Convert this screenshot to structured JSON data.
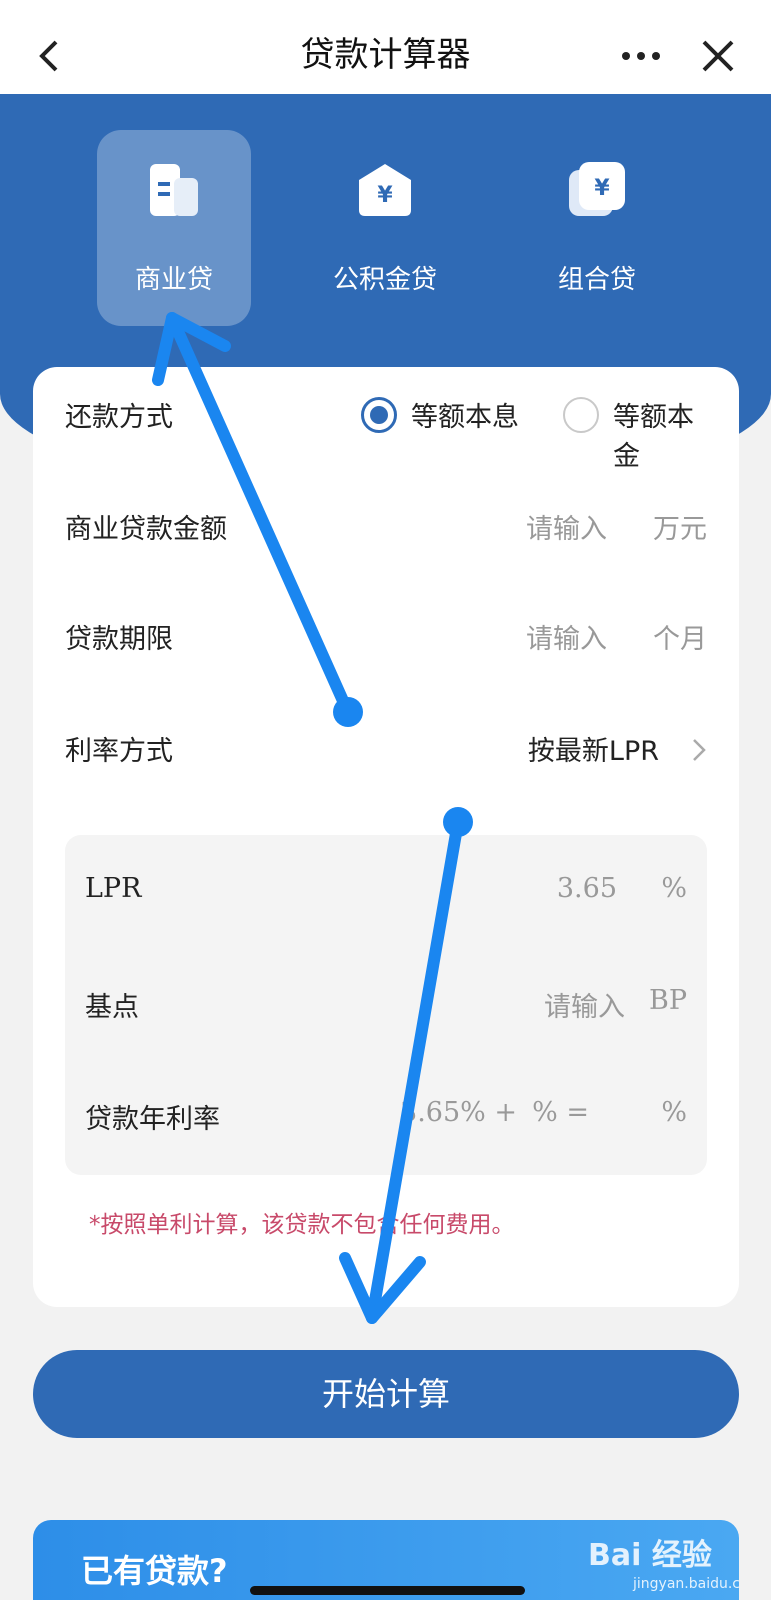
{
  "nav": {
    "title": "贷款计算器",
    "back_icon": "chevron-left-icon",
    "more_icon": "ellipsis-icon",
    "close_icon": "close-icon"
  },
  "tabs": [
    {
      "label": "商业贷",
      "icon": "building-icon",
      "active": true
    },
    {
      "label": "公积金贷",
      "icon": "house-yuan-icon",
      "active": false
    },
    {
      "label": "组合贷",
      "icon": "yuan-cards-icon",
      "active": false
    }
  ],
  "form": {
    "repay_method_label": "还款方式",
    "repay_options": [
      {
        "label": "等额本息",
        "selected": true
      },
      {
        "label": "等额本金",
        "selected": false
      }
    ],
    "amount_label": "商业贷款金额",
    "amount_placeholder": "请输入",
    "amount_unit": "万元",
    "term_label": "贷款期限",
    "term_placeholder": "请输入",
    "term_unit": "个月",
    "rate_method_label": "利率方式",
    "rate_method_value": "按最新LPR",
    "lpr_label": "LPR",
    "lpr_value": "3.65",
    "lpr_unit": "%",
    "bp_label": "基点",
    "bp_placeholder": "请输入",
    "bp_unit": "BP",
    "annual_rate_label": "贷款年利率",
    "annual_rate_formula_a": "3.65% +",
    "annual_rate_formula_b": "% =",
    "annual_rate_unit": "%",
    "note": "*按照单利计算，该贷款不包含任何费用。"
  },
  "action": {
    "calculate_label": "开始计算"
  },
  "banner": {
    "title": "已有贷款?",
    "watermark": "Bai 经验",
    "watermark_sub": "jingyan.baidu.com"
  },
  "colors": {
    "primary": "#2f6ab5",
    "note": "#c84a6a",
    "annotation_arrow": "#1a86f0"
  }
}
